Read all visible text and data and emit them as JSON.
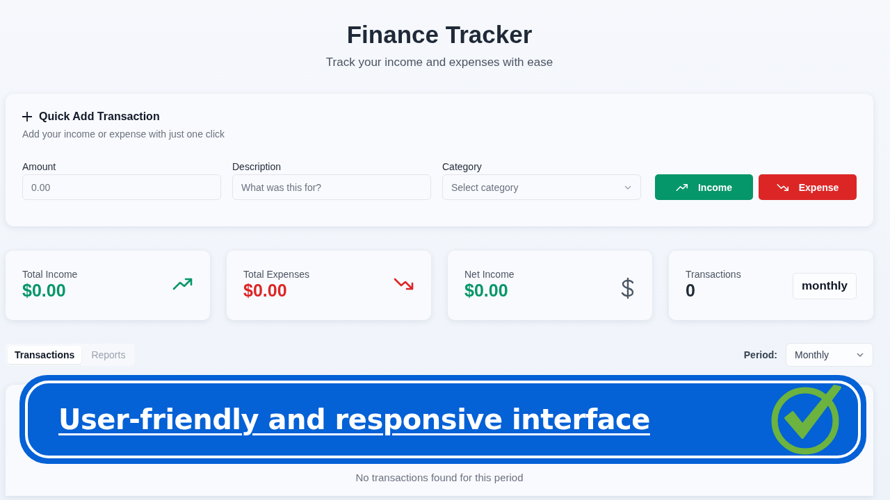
{
  "header": {
    "title": "Finance Tracker",
    "subtitle": "Track your income and expenses with ease"
  },
  "quick_add": {
    "title": "Quick Add Transaction",
    "subtitle": "Add your income or expense with just one click",
    "fields": [
      {
        "kind": "input",
        "label": "Amount",
        "placeholder": "0.00"
      },
      {
        "kind": "input",
        "label": "Description",
        "placeholder": "What was this for?"
      },
      {
        "kind": "select",
        "label": "Category",
        "placeholder": "Select category"
      }
    ],
    "buttons": [
      {
        "kind": "income",
        "label": "Income"
      },
      {
        "kind": "expense",
        "label": "Expense"
      }
    ]
  },
  "stats": [
    {
      "kind": "income",
      "label": "Total Income",
      "value": "$0.00"
    },
    {
      "kind": "expense",
      "label": "Total Expenses",
      "value": "$0.00"
    },
    {
      "kind": "net",
      "label": "Net Income",
      "value": "$0.00"
    },
    {
      "kind": "count",
      "label": "Transactions",
      "value": "0",
      "badge": "monthly"
    }
  ],
  "tabs": [
    {
      "label": "Transactions",
      "selected": true
    },
    {
      "label": "Reports",
      "selected": false
    }
  ],
  "period": {
    "label": "Period:",
    "value": "Monthly"
  },
  "empty_message": "No transactions found for this period",
  "banner": {
    "text": "User-friendly and responsive interface"
  }
}
